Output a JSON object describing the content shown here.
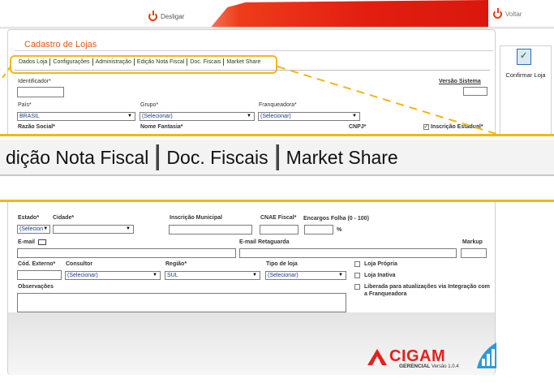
{
  "header": {
    "logout_label": "Desligar",
    "back_label": "Voltar"
  },
  "title": "Cadastro de Lojas",
  "tabs": [
    "Dados Loja",
    "Configurações",
    "Administração",
    "Edição Nota Fiscal",
    "Doc. Fiscais",
    "Market Share"
  ],
  "zoom_tabs": [
    "dição Nota Fiscal",
    "Doc. Fiscais",
    "Market Share"
  ],
  "side": {
    "confirm_label": "Confirmar Loja"
  },
  "form": {
    "identificador_label": "Identificador*",
    "versao_label": "Versão Sistema",
    "pais_label": "País*",
    "pais_value": "BRASIL",
    "grupo_label": "Grupo*",
    "grupo_value": "(Selecionar)",
    "franqueadora_label": "Franqueadora*",
    "franqueadora_value": "(Selecionar)",
    "razao_label": "Razão Social*",
    "fantasia_label": "Nome Fantasia*",
    "cnpj_label": "CNPJ*",
    "ie_label": "Inscrição Estadual*",
    "estado_label": "Estado*",
    "estado_value": "(Selecion",
    "cidade_label": "Cidade*",
    "inscr_mun_label": "Inscrição Municipal",
    "cnae_label": "CNAE Fiscal*",
    "encargos_label": "Encargos Folha (0 - 100)",
    "percent": "%",
    "email_label": "E-mail",
    "email_retag_label": "E-mail Retaguarda",
    "markup_label": "Markup",
    "cod_ext_label": "Cód. Externo*",
    "consultor_label": "Consultor",
    "consultor_value": "(Selecionar)",
    "regiao_label": "Região*",
    "regiao_value": "SUL",
    "tipo_label": "Tipo de loja",
    "tipo_value": "(Selecionar)",
    "loja_propria": "Loja Própria",
    "loja_inativa": "Loja Inativa",
    "liberada": "Liberada para atualizações via Integração com a Franqueadora",
    "obs_label": "Observações"
  },
  "logo": {
    "name": "CIGAM",
    "sub": "GERENCIAL",
    "version": "Versão 1.0.4"
  },
  "colors": {
    "accent": "#e25a1b",
    "brand_red": "#e2221b",
    "highlight": "#f2b619"
  }
}
